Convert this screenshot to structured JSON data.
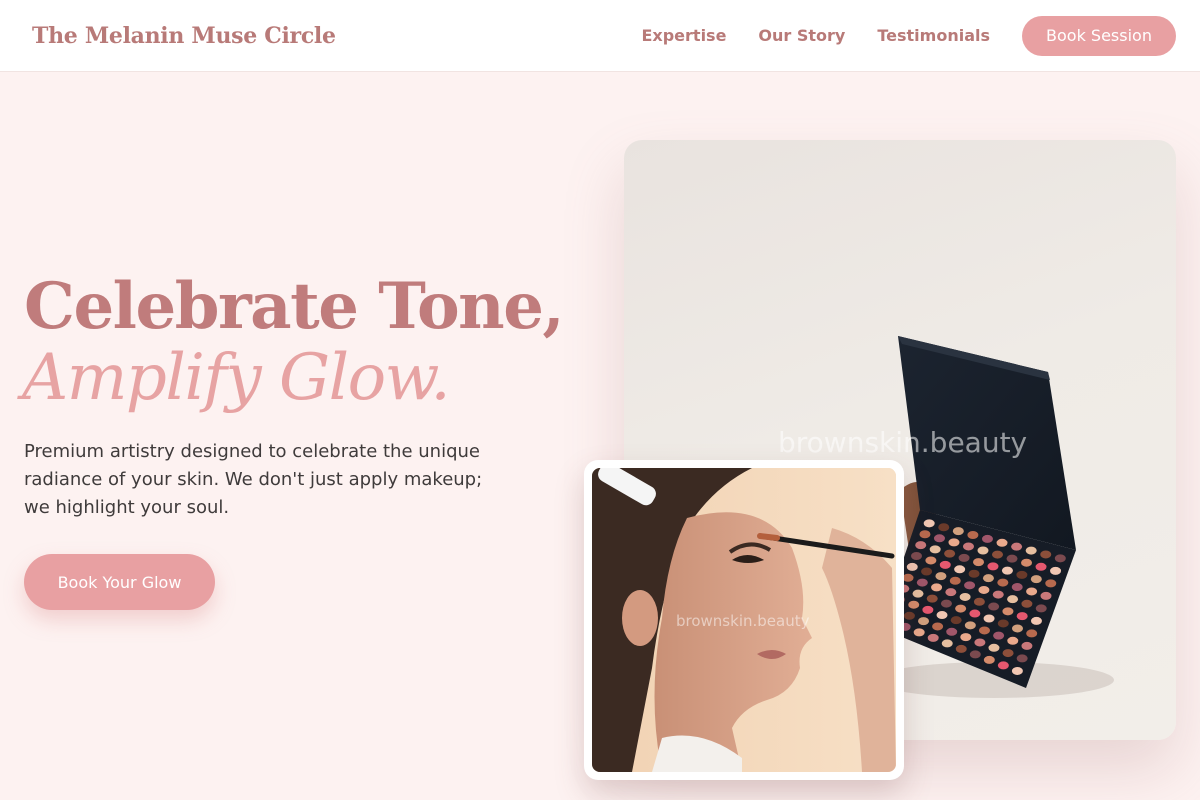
{
  "nav": {
    "logo": "The Melanin Muse Circle",
    "links": [
      "Expertise",
      "Our Story",
      "Testimonials"
    ],
    "cta": "Book Session"
  },
  "hero": {
    "title_line1": "Celebrate Tone,",
    "title_line2": "Amplify Glow.",
    "description": "Premium artistry designed to celebrate the unique radiance of your skin. We don't just apply makeup; we highlight your soul.",
    "cta": "Book Your Glow"
  },
  "images": {
    "main_watermark": "brownskin.beauty",
    "secondary_watermark": "brownskin.beauty"
  },
  "colors": {
    "accent": "#e8a0a2",
    "brand_text": "#b87a78",
    "background": "#fdf2f1"
  }
}
